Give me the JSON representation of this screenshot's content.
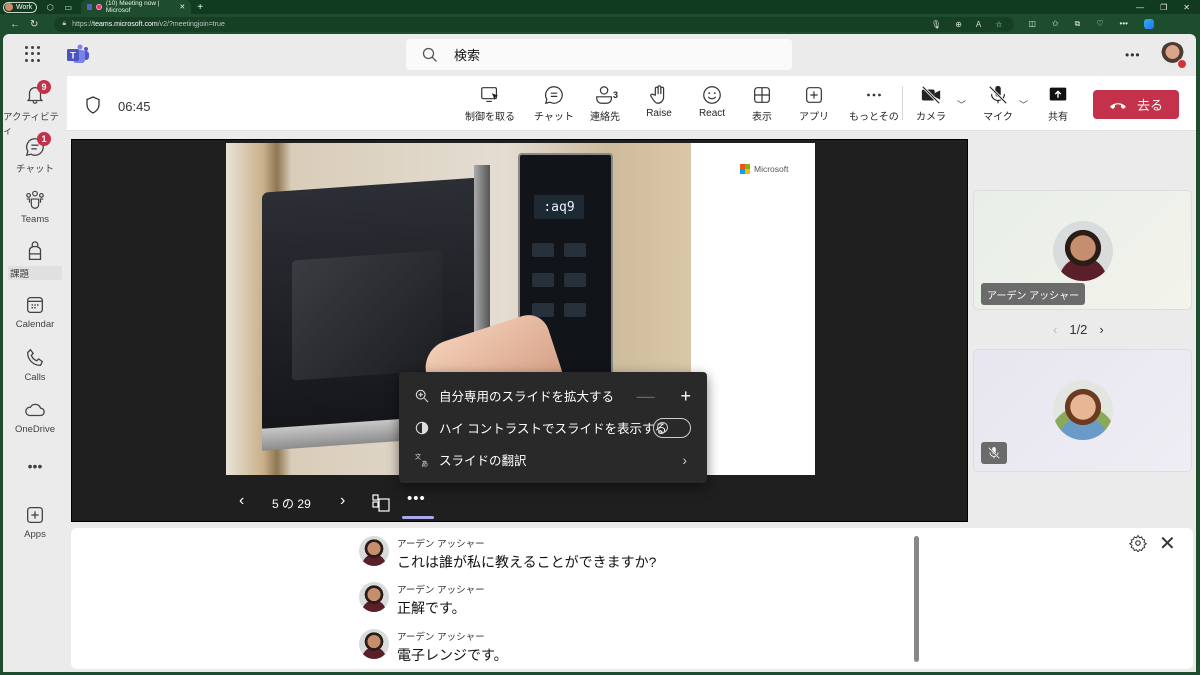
{
  "browser": {
    "profile_label": "Work",
    "tab_title": "(10) Meeting now | Microsof",
    "url_host": "teams.microsoft.com",
    "url_prefix": "https://",
    "url_path": "/v2/?meetingjoin=true"
  },
  "app": {
    "search_placeholder": "検索",
    "more_label": "•••"
  },
  "rail": {
    "items": [
      {
        "label": "アクティビティ",
        "icon": "bell-icon",
        "badge": "9"
      },
      {
        "label": "チャット",
        "icon": "chat-icon",
        "badge": "1"
      },
      {
        "label": "Teams",
        "icon": "teams-icon"
      },
      {
        "label": "課題",
        "icon": "backpack-icon"
      },
      {
        "label": "Calendar",
        "icon": "calendar-icon"
      },
      {
        "label": "Calls",
        "icon": "phone-icon"
      },
      {
        "label": "OneDrive",
        "icon": "cloud-icon"
      },
      {
        "label": "•••",
        "icon": "more-icon"
      },
      {
        "label": "Apps",
        "icon": "plus-square-icon"
      }
    ]
  },
  "meeting": {
    "timer": "06:45",
    "controls": {
      "take_control": "制御を取る",
      "chat": "チャット",
      "people": "連絡先",
      "people_count": "3",
      "raise": "Raise",
      "react": "React",
      "view": "表示",
      "apps": "アプリ",
      "more": "もっとその",
      "camera": "カメラ",
      "mic": "マイク",
      "share": "共有",
      "leave": "去る"
    },
    "colors": {
      "leave": "#c4314b",
      "accent": "#5b5fc7"
    }
  },
  "slide": {
    "brand": "Microsoft",
    "display_text": ":aq9",
    "current": "5",
    "separator": "の",
    "total": "29",
    "options_menu": {
      "zoom_label": "自分専用のスライドを拡大する",
      "contrast_label": "ハイ コントラストでスライドを表示する",
      "contrast_on": false,
      "translate_label": "スライドの翻訳"
    }
  },
  "gallery": {
    "participants": [
      {
        "name": "アーデン アッシャー",
        "muted": false
      },
      {
        "name": "",
        "muted": true
      }
    ],
    "page": "1/2"
  },
  "captions": {
    "messages": [
      {
        "speaker": "アーデン アッシャー",
        "text": "これは誰が私に教えることができますか?"
      },
      {
        "speaker": "アーデン アッシャー",
        "text": "正解です。"
      },
      {
        "speaker": "アーデン アッシャー",
        "text": "電子レンジです。"
      }
    ]
  }
}
